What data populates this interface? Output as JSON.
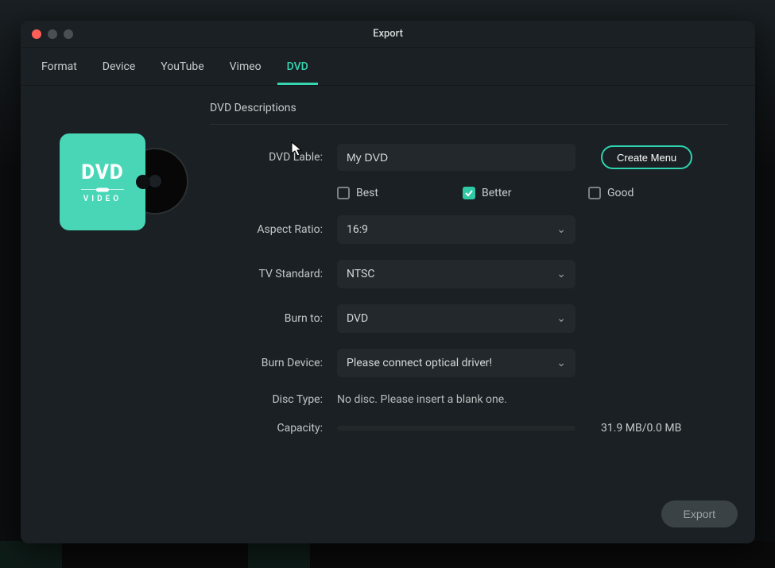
{
  "window_title": "Export",
  "tabs": [
    {
      "label": "Format"
    },
    {
      "label": "Device"
    },
    {
      "label": "YouTube"
    },
    {
      "label": "Vimeo"
    },
    {
      "label": "DVD",
      "active": true
    }
  ],
  "dvd_graphic": {
    "big": "DVD",
    "small": "VIDEO"
  },
  "section_title": "DVD Descriptions",
  "labels": {
    "dvd_label": "DVD Lable:",
    "aspect_ratio": "Aspect Ratio:",
    "tv_standard": "TV Standard:",
    "burn_to": "Burn to:",
    "burn_device": "Burn Device:",
    "disc_type": "Disc Type:",
    "capacity": "Capacity:"
  },
  "dvd_label_value": "My DVD",
  "create_menu_label": "Create Menu",
  "quality": {
    "best": {
      "label": "Best",
      "checked": false
    },
    "better": {
      "label": "Better",
      "checked": true
    },
    "good": {
      "label": "Good",
      "checked": false
    }
  },
  "aspect_ratio_value": "16:9",
  "tv_standard_value": "NTSC",
  "burn_to_value": "DVD",
  "burn_device_value": "Please connect optical driver!",
  "disc_type_value": "No disc. Please insert a blank one.",
  "capacity_text": "31.9 MB/0.0 MB",
  "export_button": "Export"
}
